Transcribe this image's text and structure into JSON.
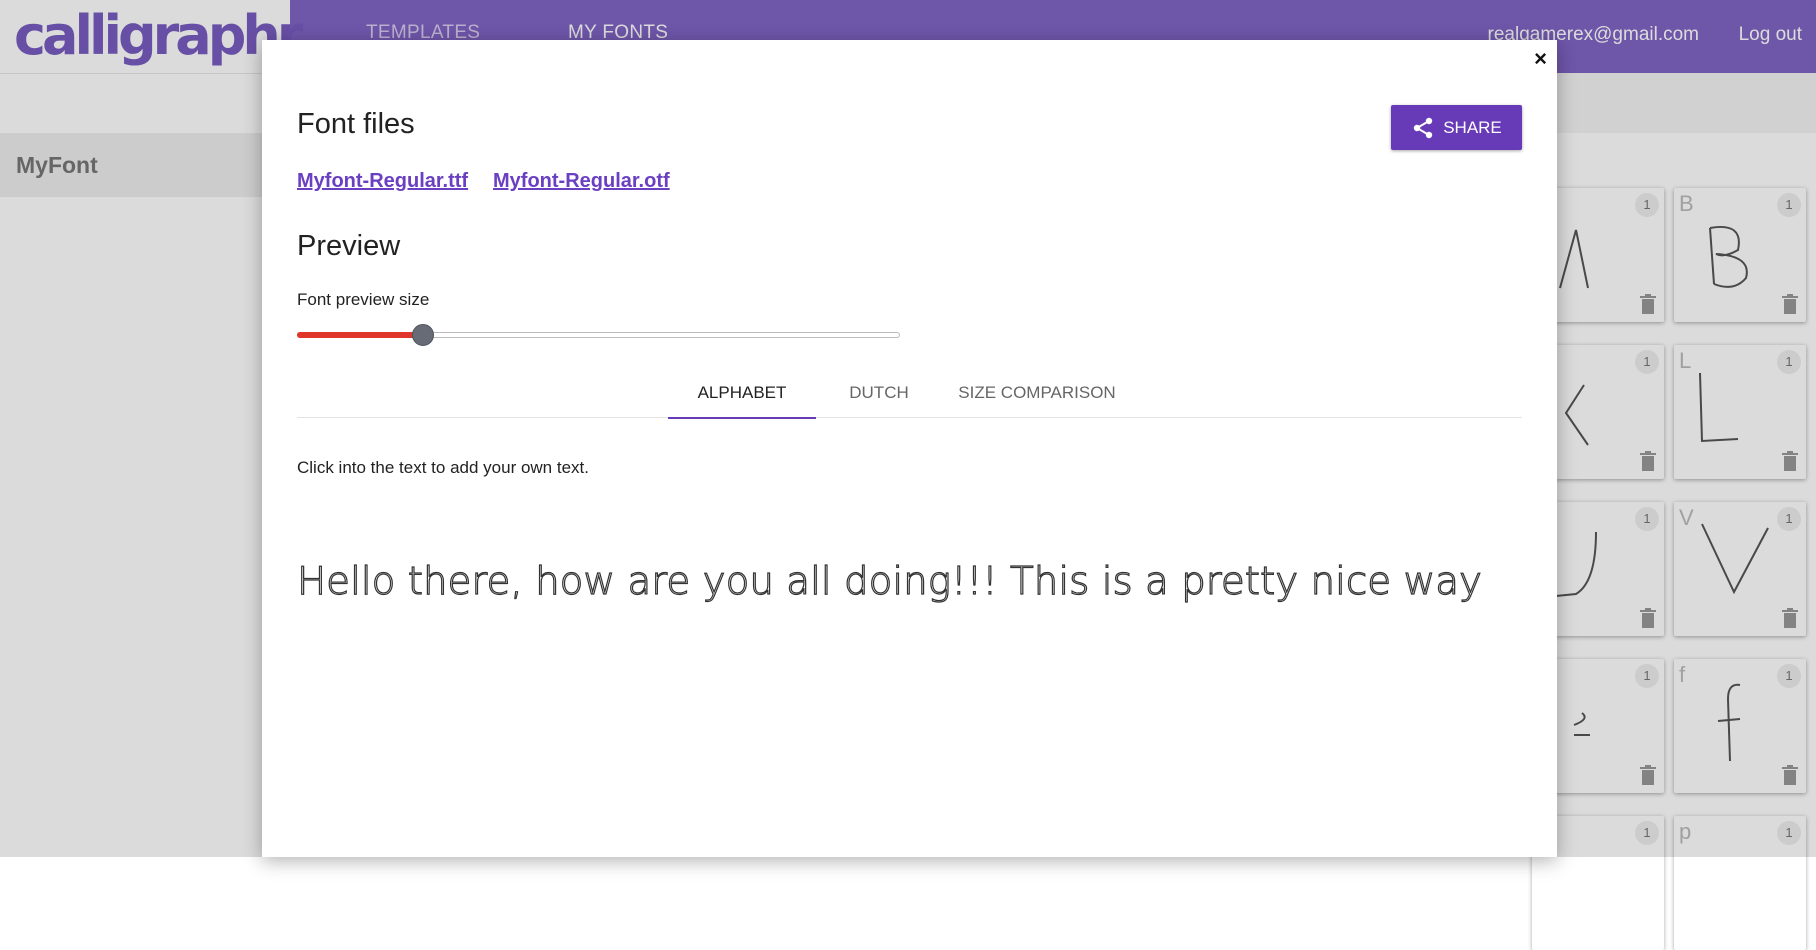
{
  "header": {
    "logo_text": "calligraphr",
    "nav": [
      "TEMPLATES",
      "MY FONTS"
    ],
    "user_email": "realgamerex@gmail.com",
    "logout_label": "Log out"
  },
  "sidebar": {
    "items": [
      {
        "label": "MyFont"
      }
    ]
  },
  "glyph_grid": {
    "cards": [
      {
        "letter": "",
        "count": "1"
      },
      {
        "letter": "B",
        "count": "1"
      },
      {
        "letter": "",
        "count": "1"
      },
      {
        "letter": "L",
        "count": "1"
      },
      {
        "letter": "",
        "count": "1"
      },
      {
        "letter": "V",
        "count": "1"
      },
      {
        "letter": "",
        "count": "1"
      },
      {
        "letter": "f",
        "count": "1"
      },
      {
        "letter": "",
        "count": "1"
      },
      {
        "letter": "p",
        "count": "1"
      }
    ]
  },
  "modal": {
    "close_label": "×",
    "font_files_title": "Font files",
    "files": [
      "Myfont-Regular.ttf",
      "Myfont-Regular.otf"
    ],
    "share_label": "SHARE",
    "preview_title": "Preview",
    "slider_label": "Font preview size",
    "slider_value_fraction": 0.21,
    "tabs": [
      "ALPHABET",
      "DUTCH",
      "SIZE COMPARISON"
    ],
    "active_tab": "ALPHABET",
    "hint": "Click into the text to add your own text.",
    "preview_text": "Hello there, how are you all doing!!! This is a pretty nice way"
  },
  "colors": {
    "brand_purple": "#8165c5",
    "button_purple": "#673ab7",
    "link_purple": "#6a3fc2",
    "slider_red": "#e0352b"
  }
}
